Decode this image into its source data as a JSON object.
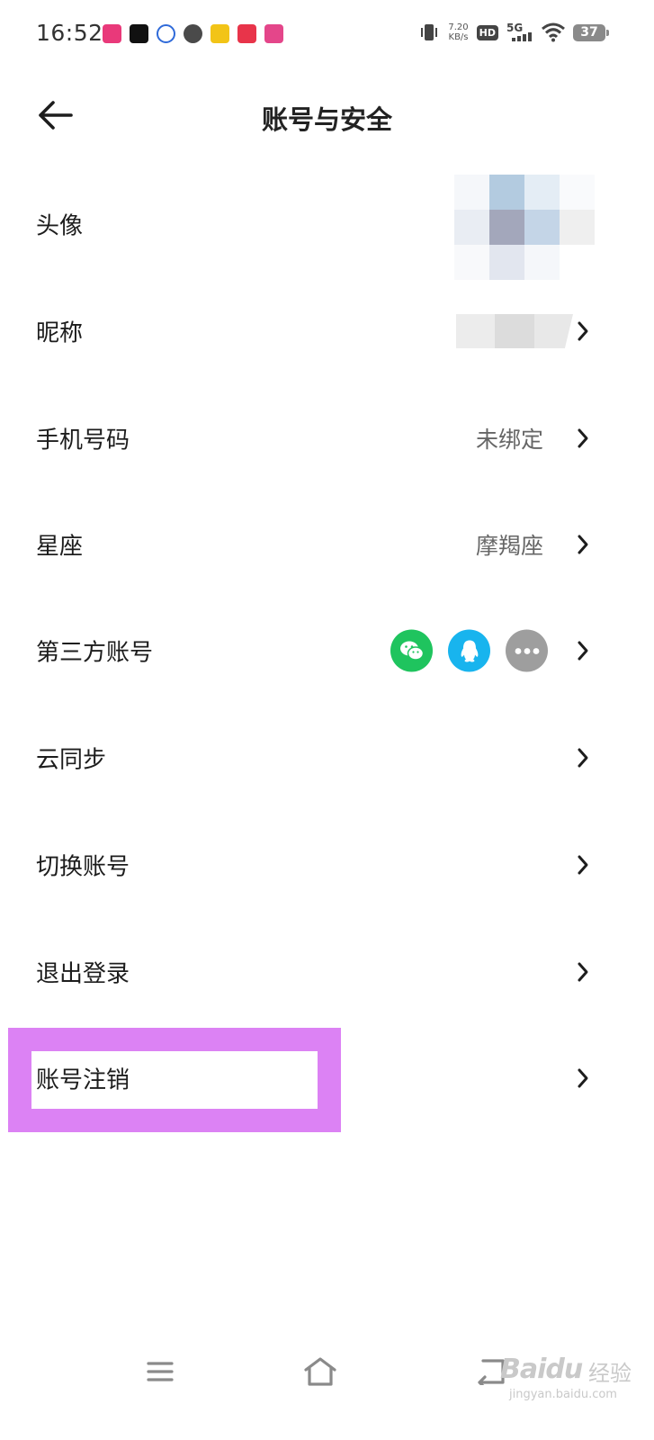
{
  "status_bar": {
    "time": "16:52",
    "speed_value": "7.20",
    "speed_unit": "KB/s",
    "hd": "HD",
    "network": "5G",
    "battery": "37",
    "app_icon_colors": [
      "#e9397a",
      "#111111",
      "#2f6ad9",
      "#4a4a4a",
      "#f2c417",
      "#e8344a",
      "#e4468a"
    ]
  },
  "header": {
    "title": "账号与安全",
    "back_icon": "arrow-left-icon"
  },
  "rows": [
    {
      "id": "avatar",
      "label": "头像",
      "value": ""
    },
    {
      "id": "nickname",
      "label": "昵称",
      "value": ""
    },
    {
      "id": "phone",
      "label": "手机号码",
      "value": "未绑定"
    },
    {
      "id": "zodiac",
      "label": "星座",
      "value": "摩羯座"
    },
    {
      "id": "third-party",
      "label": "第三方账号",
      "value": "",
      "icons": [
        "wechat-icon",
        "qq-icon",
        "more-icon"
      ]
    },
    {
      "id": "cloud-sync",
      "label": "云同步",
      "value": ""
    },
    {
      "id": "switch-account",
      "label": "切换账号",
      "value": ""
    },
    {
      "id": "logout",
      "label": "退出登录",
      "value": ""
    },
    {
      "id": "delete-account",
      "label": "账号注销",
      "value": ""
    }
  ],
  "colors": {
    "wechat": "#1fc45e",
    "qq": "#18b4ee",
    "more": "#9e9e9e",
    "highlight": "#dc82f4"
  },
  "nav_bar": {
    "icons": [
      "menu-icon",
      "home-icon",
      "back-nav-icon"
    ]
  },
  "watermark": {
    "brand": "Baidu",
    "cn": "经验",
    "sub": "jingyan.baidu.com"
  }
}
